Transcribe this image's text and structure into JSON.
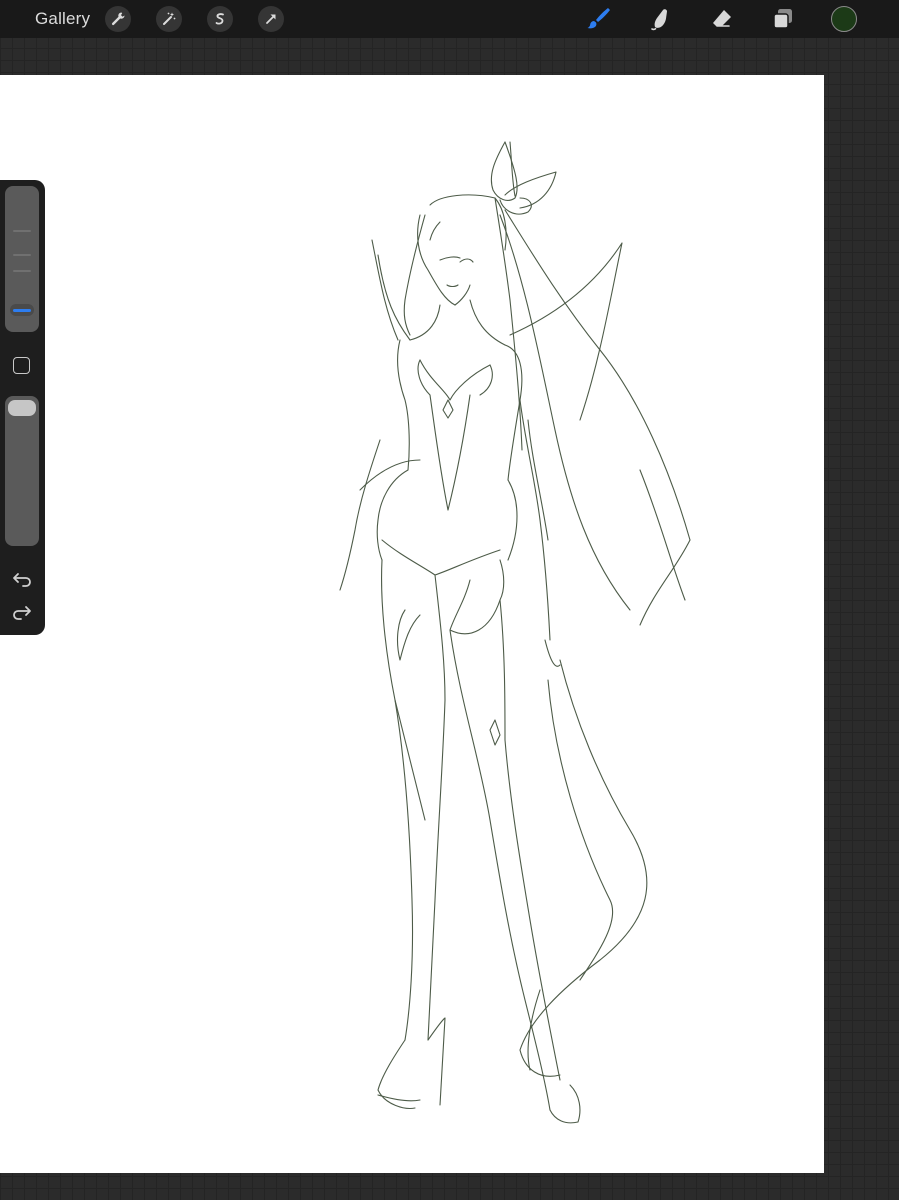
{
  "toolbar": {
    "gallery_label": "Gallery",
    "left_tools": [
      "wrench-icon",
      "magic-wand-icon",
      "selection-icon",
      "transform-arrow-icon"
    ],
    "right_tools": [
      "brush-icon",
      "smudge-icon",
      "eraser-icon",
      "layers-icon"
    ],
    "active_tool": "brush",
    "active_color": "#1c3a17",
    "accent_color": "#2d7df0"
  },
  "sidebar": {
    "brush_size_level": 0.12,
    "opacity_level": 1.0,
    "icons": [
      "modify-square-icon",
      "undo-icon",
      "redo-icon"
    ]
  },
  "canvas": {
    "background": "#ffffff",
    "stroke_color": "#3a4a35"
  }
}
